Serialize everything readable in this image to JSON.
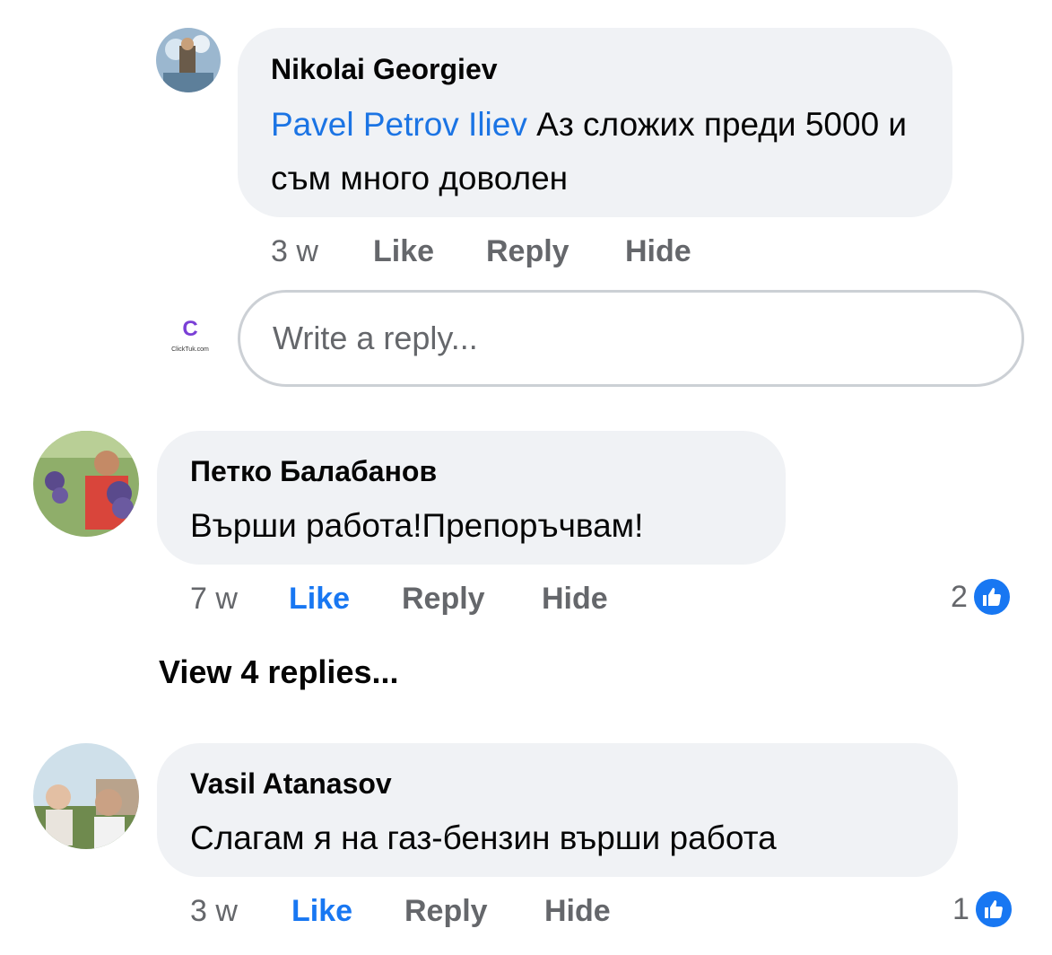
{
  "comments": [
    {
      "author": "Nikolai Georgiev",
      "mention": "Pavel Petrov Iliev",
      "text": " Аз сложих преди 5000 и съм много доволен",
      "time": "3 w",
      "like": "Like",
      "reply": "Reply",
      "hide": "Hide",
      "liked": false
    },
    {
      "author": "Петко Балабанов",
      "text": "Върши работа!Препоръчвам!",
      "time": "7 w",
      "like": "Like",
      "reply": "Reply",
      "hide": "Hide",
      "liked": true,
      "reactions": "2"
    },
    {
      "author": "Vasil Atanasov",
      "text": "Слагам я на газ-бензин върши работа",
      "time": "3 w",
      "like": "Like",
      "reply": "Reply",
      "hide": "Hide",
      "liked": true,
      "reactions": "1"
    }
  ],
  "reply_box": {
    "placeholder": "Write a reply...",
    "avatar_label": "ClickTuk.com"
  },
  "view_replies": "View 4 replies...",
  "colors": {
    "bubble": "#f0f2f5",
    "link": "#1877f2",
    "muted": "#65676b"
  },
  "icons": [
    "like-icon"
  ]
}
